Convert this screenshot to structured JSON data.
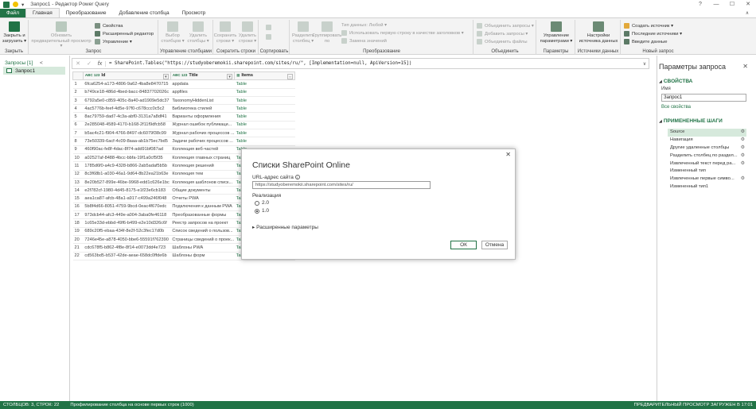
{
  "window": {
    "title": "Запрос1 - Редактор Power Query",
    "controls": [
      "?",
      "—",
      "☐",
      "✕"
    ]
  },
  "tabs": [
    {
      "label": "Файл"
    },
    {
      "label": "Главная"
    },
    {
      "label": "Преобразование"
    },
    {
      "label": "Добавление столбца"
    },
    {
      "label": "Просмотр"
    }
  ],
  "ribbon": {
    "close_load": "Закрыть и загрузить ▾",
    "group_close": "Закрыть",
    "refresh_preview": "Обновить предварительный просмотр ▾",
    "properties": "Свойства",
    "advanced_editor": "Расширенный редактор",
    "manage": "Управление ▾",
    "group_query": "Запрос",
    "choose_cols": "Выбор столбцов ▾",
    "remove_cols": "Удалить столбцы ▾",
    "group_manage_cols": "Управление столбцами",
    "keep_rows": "Сохранить строки ▾",
    "remove_rows": "Удалить строки ▾",
    "group_reduce_rows": "Сократить строки",
    "group_sort": "Сортировать",
    "split_col": "Разделить столбец ▾",
    "group_by": "Группировать по",
    "data_type": "Тип данных: Любой ▾",
    "first_row_headers": "Использовать первую строку в качестве заголовков ▾",
    "replace_values": "Замена значений",
    "group_transform": "Преобразование",
    "merge_queries": "Объединить запросы ▾",
    "append_queries": "Добавить запросы ▾",
    "combine_files": "Объединить файлы",
    "group_combine": "Объединить",
    "manage_params": "Управление параметрами ▾",
    "group_params": "Параметры",
    "ds_settings": "Настройки источника данных",
    "group_ds": "Источники данных",
    "new_source": "Создать источник ▾",
    "recent_sources": "Последние источники ▾",
    "enter_data": "Введите данные",
    "group_new_query": "Новый запрос"
  },
  "left_pane": {
    "header": "Запросы [1]",
    "collapse": "<",
    "query": "Запрос1"
  },
  "formula_bar": {
    "cancel": "✕",
    "commit": "✓",
    "fx": "fx",
    "formula": "= SharePoint.Tables(\"https://studyoberemokii.sharepoint.com/sites/ru/\", [Implementation=null, ApiVersion=15])",
    "expand": "∨"
  },
  "grid": {
    "columns": [
      {
        "type": "ABC 123",
        "name": "Id"
      },
      {
        "type": "ABC 123",
        "name": "Title"
      },
      {
        "type": "",
        "name": "Items"
      }
    ],
    "rows": [
      [
        "1",
        "6fca6254-a173-4806-9a62-4ba8e8470715",
        "appdata",
        "Table"
      ],
      [
        "2",
        "b749ce18-486d-4bed-bacc-84837702026c",
        "appfiles",
        "Table"
      ],
      [
        "3",
        "6792a5e0-c859-405c-8a40-ad1909e5dc37",
        "TaxonomyHiddenList",
        "Table"
      ],
      [
        "4",
        "4ac5776b-feef-4d5e-97f0-c678ccc0c5c2",
        "Библиотека стилей",
        "Table"
      ],
      [
        "5",
        "8ac79759-dad7-4c3a-abf0-3131a7a8df41",
        "Варианты оформления",
        "Table"
      ],
      [
        "6",
        "2e285048-4589-4170-b168-2f11f9dfcb58",
        "Журнал ошибок публикаци...",
        "Table"
      ],
      [
        "7",
        "b5ac4c21-f904-4766-8497-dc6079f38c99",
        "Журнал рабочих процессов ...",
        "Table"
      ],
      [
        "8",
        "73e50339-6acf-4c09-8aaa-ab1b75ec7bd5",
        "Задачи рабочих процессов ...",
        "Table"
      ],
      [
        "9",
        "460f90ac-fe8f-4dac-8f74-add91bf087ad",
        "Коллекция веб-частей",
        "Table"
      ],
      [
        "10",
        "a02527af-8488-4bcc-bbfa-19f1a0cf5f35",
        "Коллекция главных страниц",
        "Table"
      ],
      [
        "11",
        "1785d6f0-a4c9-4328-b866-2ab5adaf5b5b",
        "Коллекция решений",
        "Table"
      ],
      [
        "12",
        "8c3f68b1-a030-46a1-9d64-8b22ea21b63e",
        "Коллекция тем",
        "Table"
      ],
      [
        "13",
        "8e20b527-899e-46be-9968-edd1c626e1bc",
        "Коллекция шаблонов списк...",
        "Table"
      ],
      [
        "14",
        "e2f782cf-1980-4d45-8175-e1f23e6cb183",
        "Общие документы",
        "Table"
      ],
      [
        "15",
        "aea1ca87-afcb-48a1-a917-c499a246f048",
        "Отчеты PWA",
        "Table"
      ],
      [
        "16",
        "5b8f4d66-8051-4759-9bcd-0eac4f670edc",
        "Подключения к данным PWA",
        "Table"
      ],
      [
        "17",
        "973dcb44-afc3-449e-a004-3aba0fe46118",
        "Преобразованные формы",
        "Table"
      ],
      [
        "18",
        "1c65e33d-ebbd-49f6-b499-e2e10d326c6f",
        "Реестр запросов на проект",
        "Table"
      ],
      [
        "19",
        "689c20f5-ebaa-434f-8e2f-52c3fec17d0b",
        "Список сведений о пользов...",
        "Table"
      ],
      [
        "20",
        "7246e45e-a878-4050-bbe6-55591f762390",
        "Страницы сведений о проек...",
        "Table"
      ],
      [
        "21",
        "cdc678f5-b862-4f8e-8f14-e0073dd4e723",
        "Шаблоны PWA",
        "Table"
      ],
      [
        "22",
        "cd563bd5-b537-42de-aeae-658dc0ffde6b",
        "Шаблоны форм",
        "Table"
      ]
    ]
  },
  "dialog": {
    "title": "Списки SharePoint Online",
    "close": "✕",
    "url_label": "URL-адрес сайта",
    "url_info": "i",
    "url_value": "https://studyoberemokii.sharepoint.com/sites/ru/",
    "impl_label": "Реализация",
    "radio_20": "2.0",
    "radio_10": "1.0",
    "advanced": "▸ Расширенные параметры",
    "ok": "ОК",
    "cancel": "Отмена"
  },
  "right_pane": {
    "title": "Параметры запроса",
    "close": "✕",
    "properties_header": "СВОЙСТВА",
    "name_label": "Имя",
    "name_value": "Запрос1",
    "all_props": "Все свойства",
    "steps_header": "ПРИМЕНЕННЫЕ ШАГИ",
    "steps": [
      {
        "label": "Source",
        "gear": true
      },
      {
        "label": "Навигация",
        "gear": true
      },
      {
        "label": "Другие удаленные столбцы",
        "gear": true
      },
      {
        "label": "Разделить столбец по раздел...",
        "gear": true
      },
      {
        "label": "Извлеченный текст перед ра...",
        "gear": true
      },
      {
        "label": "Измененный тип",
        "gear": false
      },
      {
        "label": "Извлеченные первые симво...",
        "gear": true
      },
      {
        "label": "Измененный тип1",
        "gear": false
      }
    ]
  },
  "status": {
    "left": "СТОЛБЦОВ: 3, СТРОК: 22",
    "middle": "Профилирование столбца на основе первых строк (1000)",
    "right": "ПРЕДВАРИТЕЛЬНЫЙ ПРОСМОТР ЗАГРУЖЕН В 17:01"
  },
  "colors": {
    "accent": "#217346",
    "ribbon_bg": "#f3f3f3",
    "selected_bg": "#d6e9dc"
  }
}
